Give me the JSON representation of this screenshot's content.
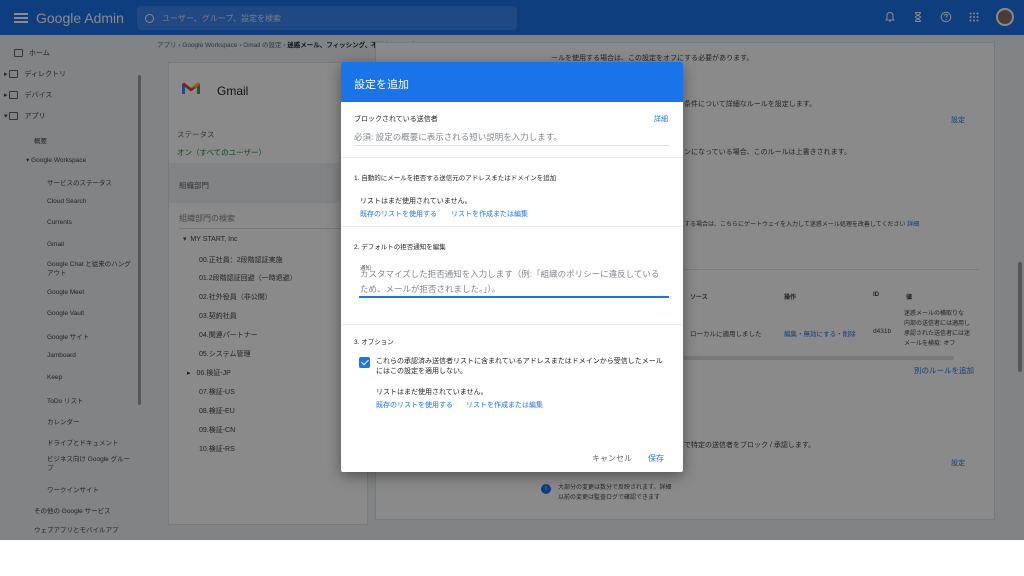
{
  "topbar": {
    "title": "Google Admin",
    "search_placeholder": "ユーザー、グループ、設定を検索",
    "icons": [
      "bell-icon",
      "hourglass-icon",
      "help-icon",
      "apps-grid-icon"
    ],
    "accent": "#1a73e8"
  },
  "sidebar": {
    "home": "ホーム",
    "directory": "ディレクトリ",
    "devices": "デバイス",
    "apps": "アプリ",
    "overview": "概要",
    "workspace": "Google Workspace",
    "items": [
      "サービスのステータス",
      "Cloud Search",
      "Currents",
      "Gmail",
      "Google Chat と従来のハングアウト",
      "Google Meet",
      "Google Vault",
      "Google サイト",
      "Jamboard",
      "Keep",
      "ToDo リスト",
      "カレンダー",
      "ドライブとドキュメント",
      "ビジネス向け Google グループ",
      "ワークインサイト"
    ],
    "other_services": "その他の Google サービス",
    "webapps": "ウェブアプリとモバイルアプ"
  },
  "breadcrumb": {
    "path": "アプリ › Google Workspace › Gmail の設定 › ",
    "current": "迷惑メール、フィッシング、不正なソフトウェア"
  },
  "left_panel": {
    "app_name": "Gmail",
    "status_label": "ステータス",
    "status_value": "オン（すべてのユーザー）",
    "org_label": "組織部門",
    "search_placeholder": "組織部門の検索",
    "root": "MY START, Inc",
    "units": [
      "00.正社員：2段階認証実施",
      "01.2段階認証回避（一時退避）",
      "02.社外役員（非公開）",
      "03.契約社員",
      "04.関連パートナー",
      "05.システム管理",
      "06.検証-JP",
      "07.検証-US",
      "08.検証-EU",
      "09.検証-CN",
      "10.検証-RS"
    ]
  },
  "right_panel": {
    "line1": "ールを使用する場合は、この設定をオフにする必要があります。",
    "line2": "条件について詳細なルールを設定します。",
    "config1": "設定",
    "line3": "ンになっている場合、このルールは上書きされます。",
    "line4": "する場合は、こちらにゲートウェイを入力して迷惑メール処理を改善してください",
    "detail": "詳細",
    "col_source": "ソース",
    "col_action": "操作",
    "col_id": "ID",
    "col_setting": "値",
    "row_source": "ローカルに適用しました",
    "row_action": "編集・無効にする・削除",
    "row_id": "d431b",
    "row_setting_lines": [
      "迷惑メールの横取りな",
      "内部の送信者には適用し",
      "承認された送信者には迷",
      "メールを検疫: オフ"
    ],
    "add_rule": "別のルールを追加",
    "line5": "で特定の送信者をブロック / 承認します。",
    "config2": "設定",
    "notice1": "大部分の変更は数分で反映されます。詳細",
    "notice2": "以前の変更は監査ログで確認できます"
  },
  "dialog": {
    "title": "設定を追加",
    "field_label": "ブロックされている送信者",
    "field_detail": "詳細",
    "field_placeholder": "必須: 設定の概要に表示される短い説明を入力します。",
    "section1": "1. 自動的にメールを拒否する送信元のアドレスまたはドメインを追加",
    "section1_empty": "リストはまだ使用されていません。",
    "use_existing": "既存のリストを使用する",
    "create_list": "リストを作成または編集",
    "section2": "2. デフォルトの拒否通知を編集",
    "notice_label": "通知",
    "notice_placeholder": "カスタマイズした拒否通知を入力します（例:「組織のポリシーに違反しているため、メールが拒否されました。」）。",
    "section3": "3. オプション",
    "option_text": "これらの承認済み送信者リストに含まれているアドレスまたはドメインから受信したメールにはこの設定を適用しない。",
    "option_checked": true,
    "section3_empty": "リストはまだ使用されていません。",
    "use_existing2": "既存のリストを使用する",
    "create_list2": "リストを作成または編集",
    "cancel": "キャンセル",
    "save": "保存"
  }
}
